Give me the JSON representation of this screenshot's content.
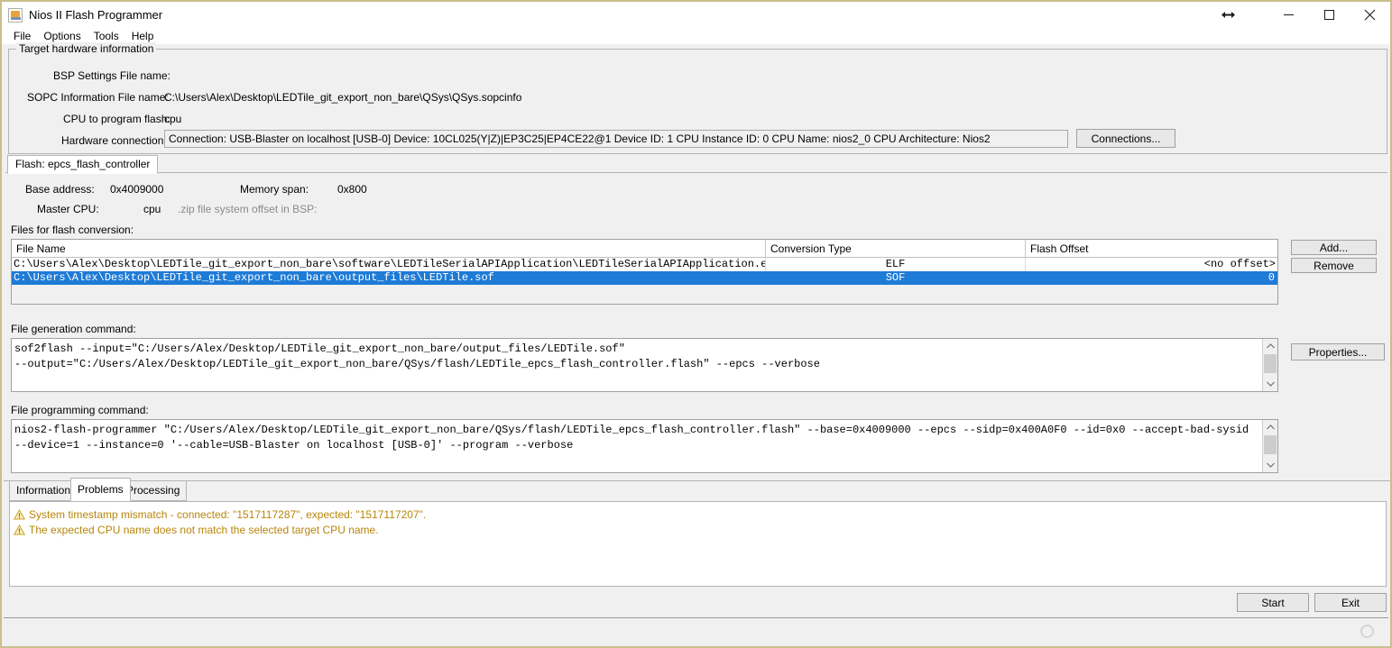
{
  "window": {
    "title": "Nios II Flash Programmer",
    "app_icon": "java-coffee-cup-icon",
    "resize_icon": "horizontal-resize-icon",
    "minimize_icon": "minimize-icon",
    "maximize_icon": "maximize-icon",
    "close_icon": "close-icon"
  },
  "menu": {
    "items": [
      {
        "label": "File"
      },
      {
        "label": "Options"
      },
      {
        "label": "Tools"
      },
      {
        "label": "Help"
      }
    ]
  },
  "target_hardware": {
    "group_title": "Target hardware information",
    "bsp_label": "BSP Settings File name:",
    "bsp_value": "",
    "sopc_label": "SOPC Information File name:",
    "sopc_value": "C:\\Users\\Alex\\Desktop\\LEDTile_git_export_non_bare\\QSys\\QSys.sopcinfo",
    "cpu_label": "CPU to program flash:",
    "cpu_value": "cpu",
    "hw_label": "Hardware connection:",
    "hw_value": "Connection: USB-Blaster on localhost [USB-0]    Device: 10CL025(Y|Z)|EP3C25|EP4CE22@1    Device ID: 1    CPU Instance ID: 0    CPU Name: nios2_0    CPU Architecture: Nios2",
    "connections_button": "Connections..."
  },
  "flash_tab": {
    "label": "Flash: epcs_flash_controller",
    "base_address_label": "Base address:",
    "base_address_value": "0x4009000",
    "memory_span_label": "Memory span:",
    "memory_span_value": "0x800",
    "master_cpu_label": "Master CPU:",
    "master_cpu_value": "cpu",
    "zip_offset_label": ".zip file system offset in BSP:",
    "zip_offset_value": ""
  },
  "files_section": {
    "label": "Files for flash conversion:",
    "columns": [
      "File Name",
      "Conversion Type",
      "Flash Offset"
    ],
    "rows": [
      {
        "file_name": "C:\\Users\\Alex\\Desktop\\LEDTile_git_export_non_bare\\software\\LEDTileSerialAPIApplication\\LEDTileSerialAPIApplication.elf",
        "conversion_type": "ELF",
        "flash_offset": "<no offset>",
        "selected": false
      },
      {
        "file_name": "C:\\Users\\Alex\\Desktop\\LEDTile_git_export_non_bare\\output_files\\LEDTile.sof",
        "conversion_type": "SOF",
        "flash_offset": "0",
        "selected": true
      }
    ],
    "add_button": "Add...",
    "remove_button": "Remove"
  },
  "file_generation": {
    "label": "File generation command:",
    "text": "sof2flash --input=\"C:/Users/Alex/Desktop/LEDTile_git_export_non_bare/output_files/LEDTile.sof\"\n--output=\"C:/Users/Alex/Desktop/LEDTile_git_export_non_bare/QSys/flash/LEDTile_epcs_flash_controller.flash\" --epcs --verbose",
    "properties_button": "Properties..."
  },
  "file_programming": {
    "label": "File programming command:",
    "text": "nios2-flash-programmer \"C:/Users/Alex/Desktop/LEDTile_git_export_non_bare/QSys/flash/LEDTile_epcs_flash_controller.flash\" --base=0x4009000 --epcs --sidp=0x400A0F0 --id=0x0 --accept-bad-sysid\n--device=1 --instance=0 '--cable=USB-Blaster on localhost [USB-0]' --program --verbose"
  },
  "bottom_tabs": {
    "items": [
      {
        "label": "Information",
        "active": false
      },
      {
        "label": "Problems",
        "active": true
      },
      {
        "label": "Processing",
        "active": false
      }
    ]
  },
  "problems": {
    "messages": [
      "System timestamp mismatch - connected: \"1517117287\", expected: \"1517117207\".",
      "The expected CPU name does not match the selected target CPU name."
    ],
    "warning_icon": "warning-triangle-icon",
    "text_color": "#b8860b"
  },
  "actions": {
    "start_button": "Start",
    "exit_button": "Exit"
  },
  "status": {
    "spinner_icon": "progress-spinner-icon"
  },
  "colors": {
    "selection_blue": "#1e7bd6",
    "window_border": "#c8bf8c",
    "panel_bg": "#f0f0f0",
    "warning": "#b8860b"
  }
}
